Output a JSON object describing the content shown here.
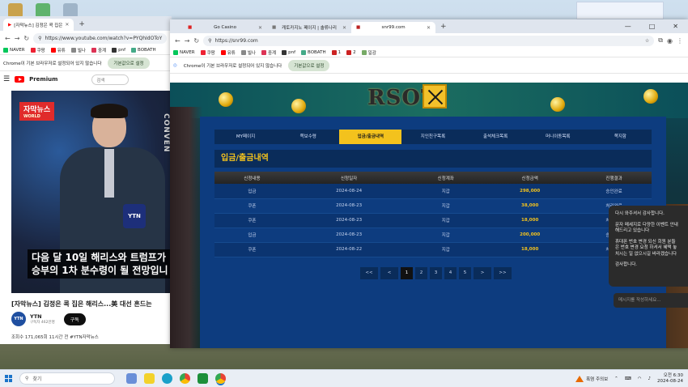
{
  "left_window": {
    "tab_title": "[자막뉴스] 김정은 콕 집은",
    "url": "https://www.youtube.com/watch?v=PYQhIdOToY",
    "bookmarks": [
      "NAVER",
      "쿠팡",
      "유튜",
      "빌나",
      "중계",
      "pnf",
      "BOBATH"
    ],
    "infobar_text": "Chrome이 기본 브라우저로 설정되어 있지 않습니다",
    "infobar_button": "기본값으로 설정",
    "brand": "Premium",
    "search_placeholder": "검색",
    "video": {
      "badge": "자막뉴스",
      "badge_sub": "WORLD",
      "side_text": "CONVEN",
      "mic_label": "YTN",
      "caption_line1": "다음 달 10일 해리스와 트럼프가",
      "caption_line2": "승부의 1차 분수령이 될 전망입니"
    },
    "video_title": "[자막뉴스] 김정은 콕 집은 해리스...美 대선 흔드는",
    "channel_name": "YTN",
    "channel_subs": "구독자 462만명",
    "subscribe": "구독",
    "stats": "조회수 171,065회  11시간 전  #YTN자막뉴스"
  },
  "right_window": {
    "tabs": [
      "Go Casino",
      "캐토카지노 페이지 | 솔류나리",
      "snr99.com"
    ],
    "url": "https://snr99.com",
    "bookmarks": [
      "NAVER",
      "쿠팡",
      "유튜",
      "빌나",
      "중계",
      "pnf",
      "BOBATH",
      "1",
      "2",
      "일감"
    ],
    "infobar_text": "Chrome이 기본 브라우저로 설정되어 있지 않습니다",
    "infobar_button": "기본값으로 설정",
    "site": {
      "logo_text": "RSOT",
      "menu": [
        "MY페이지",
        "쪽보수령",
        "입금/출금내역",
        "지인친구목록",
        "출석체크목록",
        "머니이동목록",
        "쪽지함"
      ],
      "active_menu_index": 2,
      "section_title": "입금/출금내역",
      "table": {
        "headers": [
          "신청내용",
          "신청일자",
          "신청계좌",
          "신청금액",
          "진행결과"
        ],
        "rows": [
          [
            "입금",
            "2024-08-24",
            "지갑",
            "298,000",
            "승인완료"
          ],
          [
            "쿠폰",
            "2024-08-23",
            "지갑",
            "38,000",
            "처리완료"
          ],
          [
            "쿠폰",
            "2024-08-23",
            "지갑",
            "18,000",
            "처리완료"
          ],
          [
            "입금",
            "2024-08-23",
            "지갑",
            "200,000",
            "승인완료"
          ],
          [
            "쿠폰",
            "2024-08-22",
            "지갑",
            "18,000",
            "처리완료"
          ]
        ]
      },
      "pager": [
        "<<",
        "<",
        "1",
        "2",
        "3",
        "4",
        "5",
        ">",
        ">>"
      ],
      "active_page": "1"
    }
  },
  "chat": {
    "lines": [
      "다시 와주셔서 감사합니다.",
      "문자 메세지로 다양한 이벤트 안내",
      "해드리고 있습니다",
      "휴대폰 번호 변경 되신 회원 분들",
      "은 번호 변경 요청 하셔서 혜택 놓",
      "치시는 일 없으시길 바라겠습니다",
      "감사합니다."
    ],
    "input_placeholder": "메시지를 작성하세요..."
  },
  "taskbar": {
    "search": "찾기",
    "weather": "폭염 주의보",
    "time": "오전 6:30",
    "date": "2024-08-24"
  },
  "colors": {
    "panel_blue": "#0d3c7f",
    "accent_gold": "#f3c21d",
    "header_dark": "#242424"
  }
}
